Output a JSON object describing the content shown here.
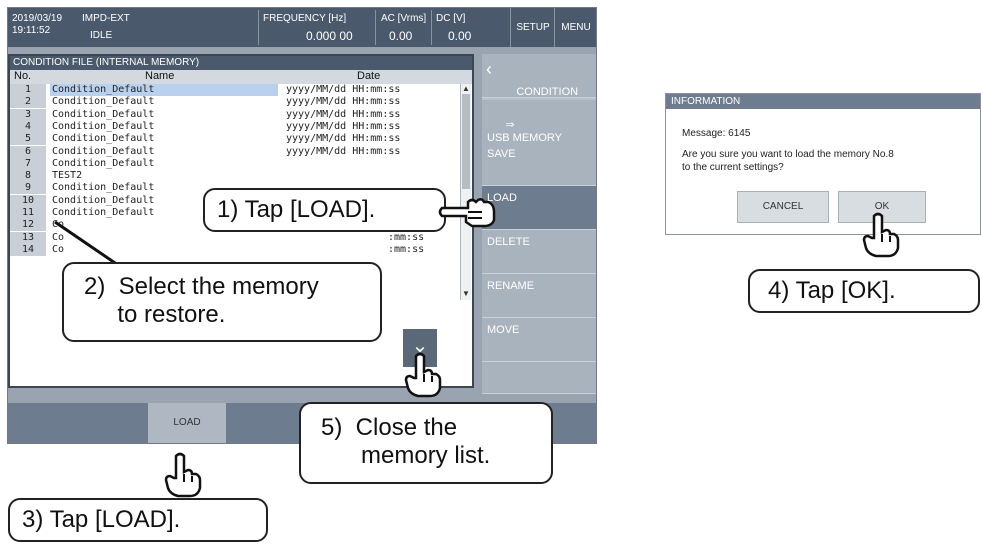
{
  "status_bar": {
    "datetime": "2019/03/19\n19:11:52",
    "mode": "IMPD-EXT",
    "state": "IDLE",
    "frequency_label": "FREQUENCY [Hz]",
    "frequency_value": "0.000 00",
    "ac_label": "AC [Vrms]",
    "ac_value": "0.00",
    "dc_label": "DC [V]",
    "dc_value": "0.00",
    "setup_label": "SETUP",
    "menu_label": "MENU"
  },
  "file_panel": {
    "title": "CONDITION FILE (INTERNAL MEMORY)",
    "columns": [
      "No.",
      "Name",
      "Date"
    ],
    "rows": [
      {
        "no": "1",
        "name": "Condition_Default",
        "date": "yyyy/MM/dd HH:mm:ss"
      },
      {
        "no": "2",
        "name": "Condition_Default",
        "date": "yyyy/MM/dd HH:mm:ss"
      },
      {
        "no": "3",
        "name": "Condition_Default",
        "date": "yyyy/MM/dd HH:mm:ss"
      },
      {
        "no": "4",
        "name": "Condition_Default",
        "date": "yyyy/MM/dd HH:mm:ss"
      },
      {
        "no": "5",
        "name": "Condition_Default",
        "date": "yyyy/MM/dd HH:mm:ss"
      },
      {
        "no": "6",
        "name": "Condition_Default",
        "date": "yyyy/MM/dd HH:mm:ss"
      },
      {
        "no": "7",
        "name": "Condition_Default",
        "date": ""
      },
      {
        "no": "8",
        "name": "TEST2",
        "date": ""
      },
      {
        "no": "9",
        "name": "Condition_Default",
        "date": ""
      },
      {
        "no": "10",
        "name": "Condition_Default",
        "date": "yyyy/MM/dd HH:mm:ss"
      },
      {
        "no": "11",
        "name": "Condition_Default",
        "date": "yyyy/MM/dd HH:mm:ss"
      },
      {
        "no": "12",
        "name": "Co",
        "date": ":mm:ss"
      },
      {
        "no": "13",
        "name": "Co",
        "date": ":mm:ss"
      },
      {
        "no": "14",
        "name": "Co",
        "date": ":mm:ss"
      }
    ],
    "close_glyph": "⌄"
  },
  "side_panel": {
    "items": [
      {
        "label": "CONDITION\nFILE (INT MEM)",
        "icon": "chevron-left-icon"
      },
      {
        "label": "⇒\nUSB MEMORY"
      },
      {
        "label": "SAVE"
      },
      {
        "label": "LOAD"
      },
      {
        "label": "DELETE"
      },
      {
        "label": "RENAME"
      },
      {
        "label": "MOVE"
      }
    ]
  },
  "bottom_bar": {
    "load_label": "LOAD"
  },
  "dialog": {
    "title": "INFORMATION",
    "message_line1": "Message: 6145",
    "message_line2": "Are you sure you want to load the memory No.8",
    "message_line3": "to the current settings?",
    "cancel_label": "CANCEL",
    "ok_label": "OK"
  },
  "callouts": {
    "step1": "1) Tap [LOAD].",
    "step2": "2)  Select the memory\n     to restore.",
    "step3": "3) Tap [LOAD].",
    "step4": "4) Tap [OK].",
    "step5": "5)  Close the\n      memory list."
  },
  "colors": {
    "status_bar": "#4a5a6c",
    "panel_bg": "#9aa4b0",
    "selected_row": "#b9d1ec"
  }
}
